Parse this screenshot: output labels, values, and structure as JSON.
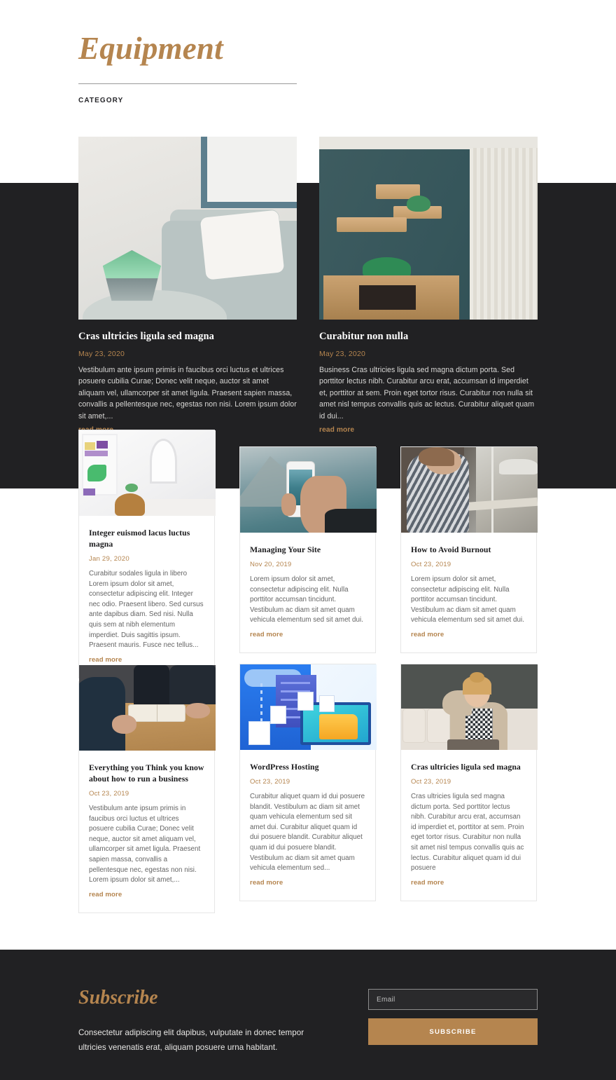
{
  "header": {
    "title": "Equipment",
    "category_label": "CATEGORY"
  },
  "colors": {
    "accent": "#b5854f",
    "dark_band": "#212123",
    "page_bg": "#ffffff",
    "body_text": "#646464",
    "card_border": "#e6e6e6"
  },
  "read_more_label": "read more",
  "featured_posts": [
    {
      "title": "Cras ultricies ligula sed magna",
      "date": "May 23, 2020",
      "excerpt": "Vestibulum ante ipsum primis in faucibus orci luctus et ultrices posuere cubilia Curae; Donec velit neque, auctor sit amet aliquam vel, ullamcorper sit amet ligula. Praesent sapien massa, convallis a pellentesque nec, egestas non nisi. Lorem ipsum dolor sit amet,...",
      "read_more": "read more",
      "image_alt": "gray-armchair-with-white-pillow-and-terrarium"
    },
    {
      "title": "Curabitur non nulla",
      "date": "May 23, 2020",
      "excerpt": "Business Cras ultricies ligula sed magna dictum porta. Sed porttitor lectus nibh. Curabitur arcu erat, accumsan id imperdiet et, porttitor at sem. Proin eget tortor risus. Curabitur non nulla sit amet nisl tempus convallis quis ac lectus. Curabitur aliquet quam id dui...",
      "read_more": "read more",
      "image_alt": "teal-wall-with-wooden-floating-shelves-and-console"
    }
  ],
  "grid_rows": [
    [
      {
        "title": "Integer euismod lacus luctus magna",
        "date": "Jan 29, 2020",
        "excerpt": "Curabitur sodales ligula in libero Lorem ipsum dolor sit amet, consectetur adipiscing elit. Integer nec odio. Praesent libero. Sed cursus ante dapibus diam. Sed nisi. Nulla quis sem at nibh elementum imperdiet. Duis sagittis ipsum. Praesent mauris. Fusce nec tellus...",
        "read_more": "read more",
        "image_alt": "bright-white-room-with-stained-glass-window"
      },
      {
        "title": "Managing Your Site",
        "date": "Nov 20, 2019",
        "excerpt": "Lorem ipsum dolor sit amet, consectetur adipiscing elit. Nulla porttitor accumsan tincidunt. Vestibulum ac diam sit amet quam vehicula elementum sed sit amet dui.",
        "read_more": "read more",
        "image_alt": "hand-holding-phone-photographing-mountain-lake"
      },
      {
        "title": "How to Avoid Burnout",
        "date": "Oct 23, 2019",
        "excerpt": "Lorem ipsum dolor sit amet, consectetur adipiscing elit. Nulla porttitor accumsan tincidunt. Vestibulum ac diam sit amet quam vehicula elementum sed sit amet dui.",
        "read_more": "read more",
        "image_alt": "woman-in-striped-shirt-looking-out-window"
      }
    ],
    [
      {
        "title": "Everything you Think you know about how to run a business",
        "date": "Oct 23, 2019",
        "excerpt": "Vestibulum ante ipsum primis in faucibus orci luctus et ultrices posuere cubilia Curae; Donec velit neque, auctor sit amet aliquam vel, ullamcorper sit amet ligula. Praesent sapien massa, convallis a pellentesque nec, egestas non nisi. Lorem ipsum dolor sit amet,...",
        "read_more": "read more",
        "image_alt": "business-people-at-wooden-table-with-open-book"
      },
      {
        "title": "WordPress Hosting",
        "date": "Oct 23, 2019",
        "excerpt": "Curabitur aliquet quam id dui posuere blandit. Vestibulum ac diam sit amet quam vehicula elementum sed sit amet dui. Curabitur aliquet quam id dui posuere blandit. Curabitur aliquet quam id dui posuere blandit. Vestibulum ac diam sit amet quam vehicula elementum sed...",
        "read_more": "read more",
        "image_alt": "blue-cloud-hosting-illustration-with-servers-and-folder"
      },
      {
        "title": "Cras ultricies ligula sed magna",
        "date": "Oct 23, 2019",
        "excerpt": "Cras ultricies ligula sed magna dictum porta. Sed porttitor lectus nibh. Curabitur arcu erat, accumsan id imperdiet et, porttitor at sem. Proin eget tortor risus. Curabitur non nulla sit amet nisl tempus convallis quis ac lectus. Curabitur aliquet quam id dui posuere",
        "read_more": "read more",
        "image_alt": "smiling-woman-on-sofa-with-laptop"
      }
    ]
  ],
  "footer": {
    "title": "Subscribe",
    "description": "Consectetur adipiscing elit dapibus, vulputate in donec tempor ultricies venenatis erat, aliquam posuere urna habitant.",
    "email_placeholder": "Email",
    "email_value": "",
    "button_label": "SUBSCRIBE"
  }
}
